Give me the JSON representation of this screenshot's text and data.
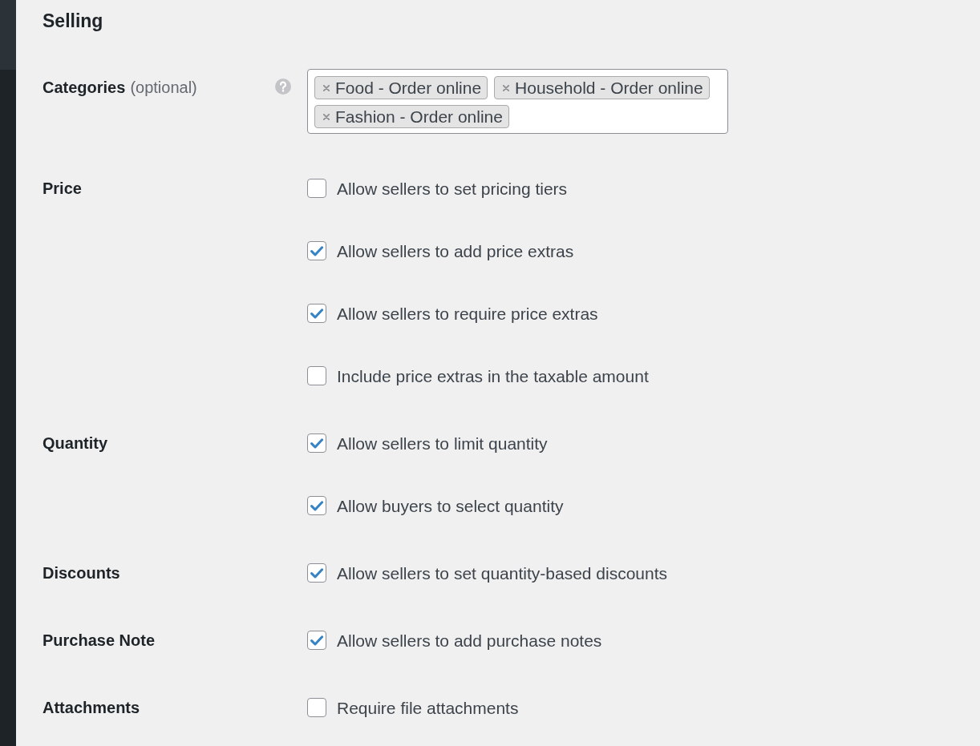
{
  "heading": "Selling",
  "sections": [
    {
      "kind": "tags",
      "label": "Categories",
      "label_note": "(optional)",
      "help": true,
      "tags": [
        {
          "label": "Food - Order online"
        },
        {
          "label": "Household - Order online"
        },
        {
          "label": "Fashion - Order online"
        }
      ]
    },
    {
      "kind": "checkboxes",
      "label": "Price",
      "help": false,
      "options": [
        {
          "label": "Allow sellers to set pricing tiers",
          "checked": false
        },
        {
          "label": "Allow sellers to add price extras",
          "checked": true
        },
        {
          "label": "Allow sellers to require price extras",
          "checked": true
        },
        {
          "label": "Include price extras in the taxable amount",
          "checked": false
        }
      ]
    },
    {
      "kind": "checkboxes",
      "label": "Quantity",
      "help": false,
      "options": [
        {
          "label": "Allow sellers to limit quantity",
          "checked": true
        },
        {
          "label": "Allow buyers to select quantity",
          "checked": true
        }
      ]
    },
    {
      "kind": "checkboxes",
      "label": "Discounts",
      "help": false,
      "options": [
        {
          "label": "Allow sellers to set quantity-based discounts",
          "checked": true
        }
      ]
    },
    {
      "kind": "checkboxes",
      "label": "Purchase Note",
      "help": false,
      "options": [
        {
          "label": "Allow sellers to add purchase notes",
          "checked": true
        }
      ]
    },
    {
      "kind": "checkboxes",
      "label": "Attachments",
      "help": false,
      "options": [
        {
          "label": "Require file attachments",
          "checked": false
        }
      ]
    }
  ]
}
